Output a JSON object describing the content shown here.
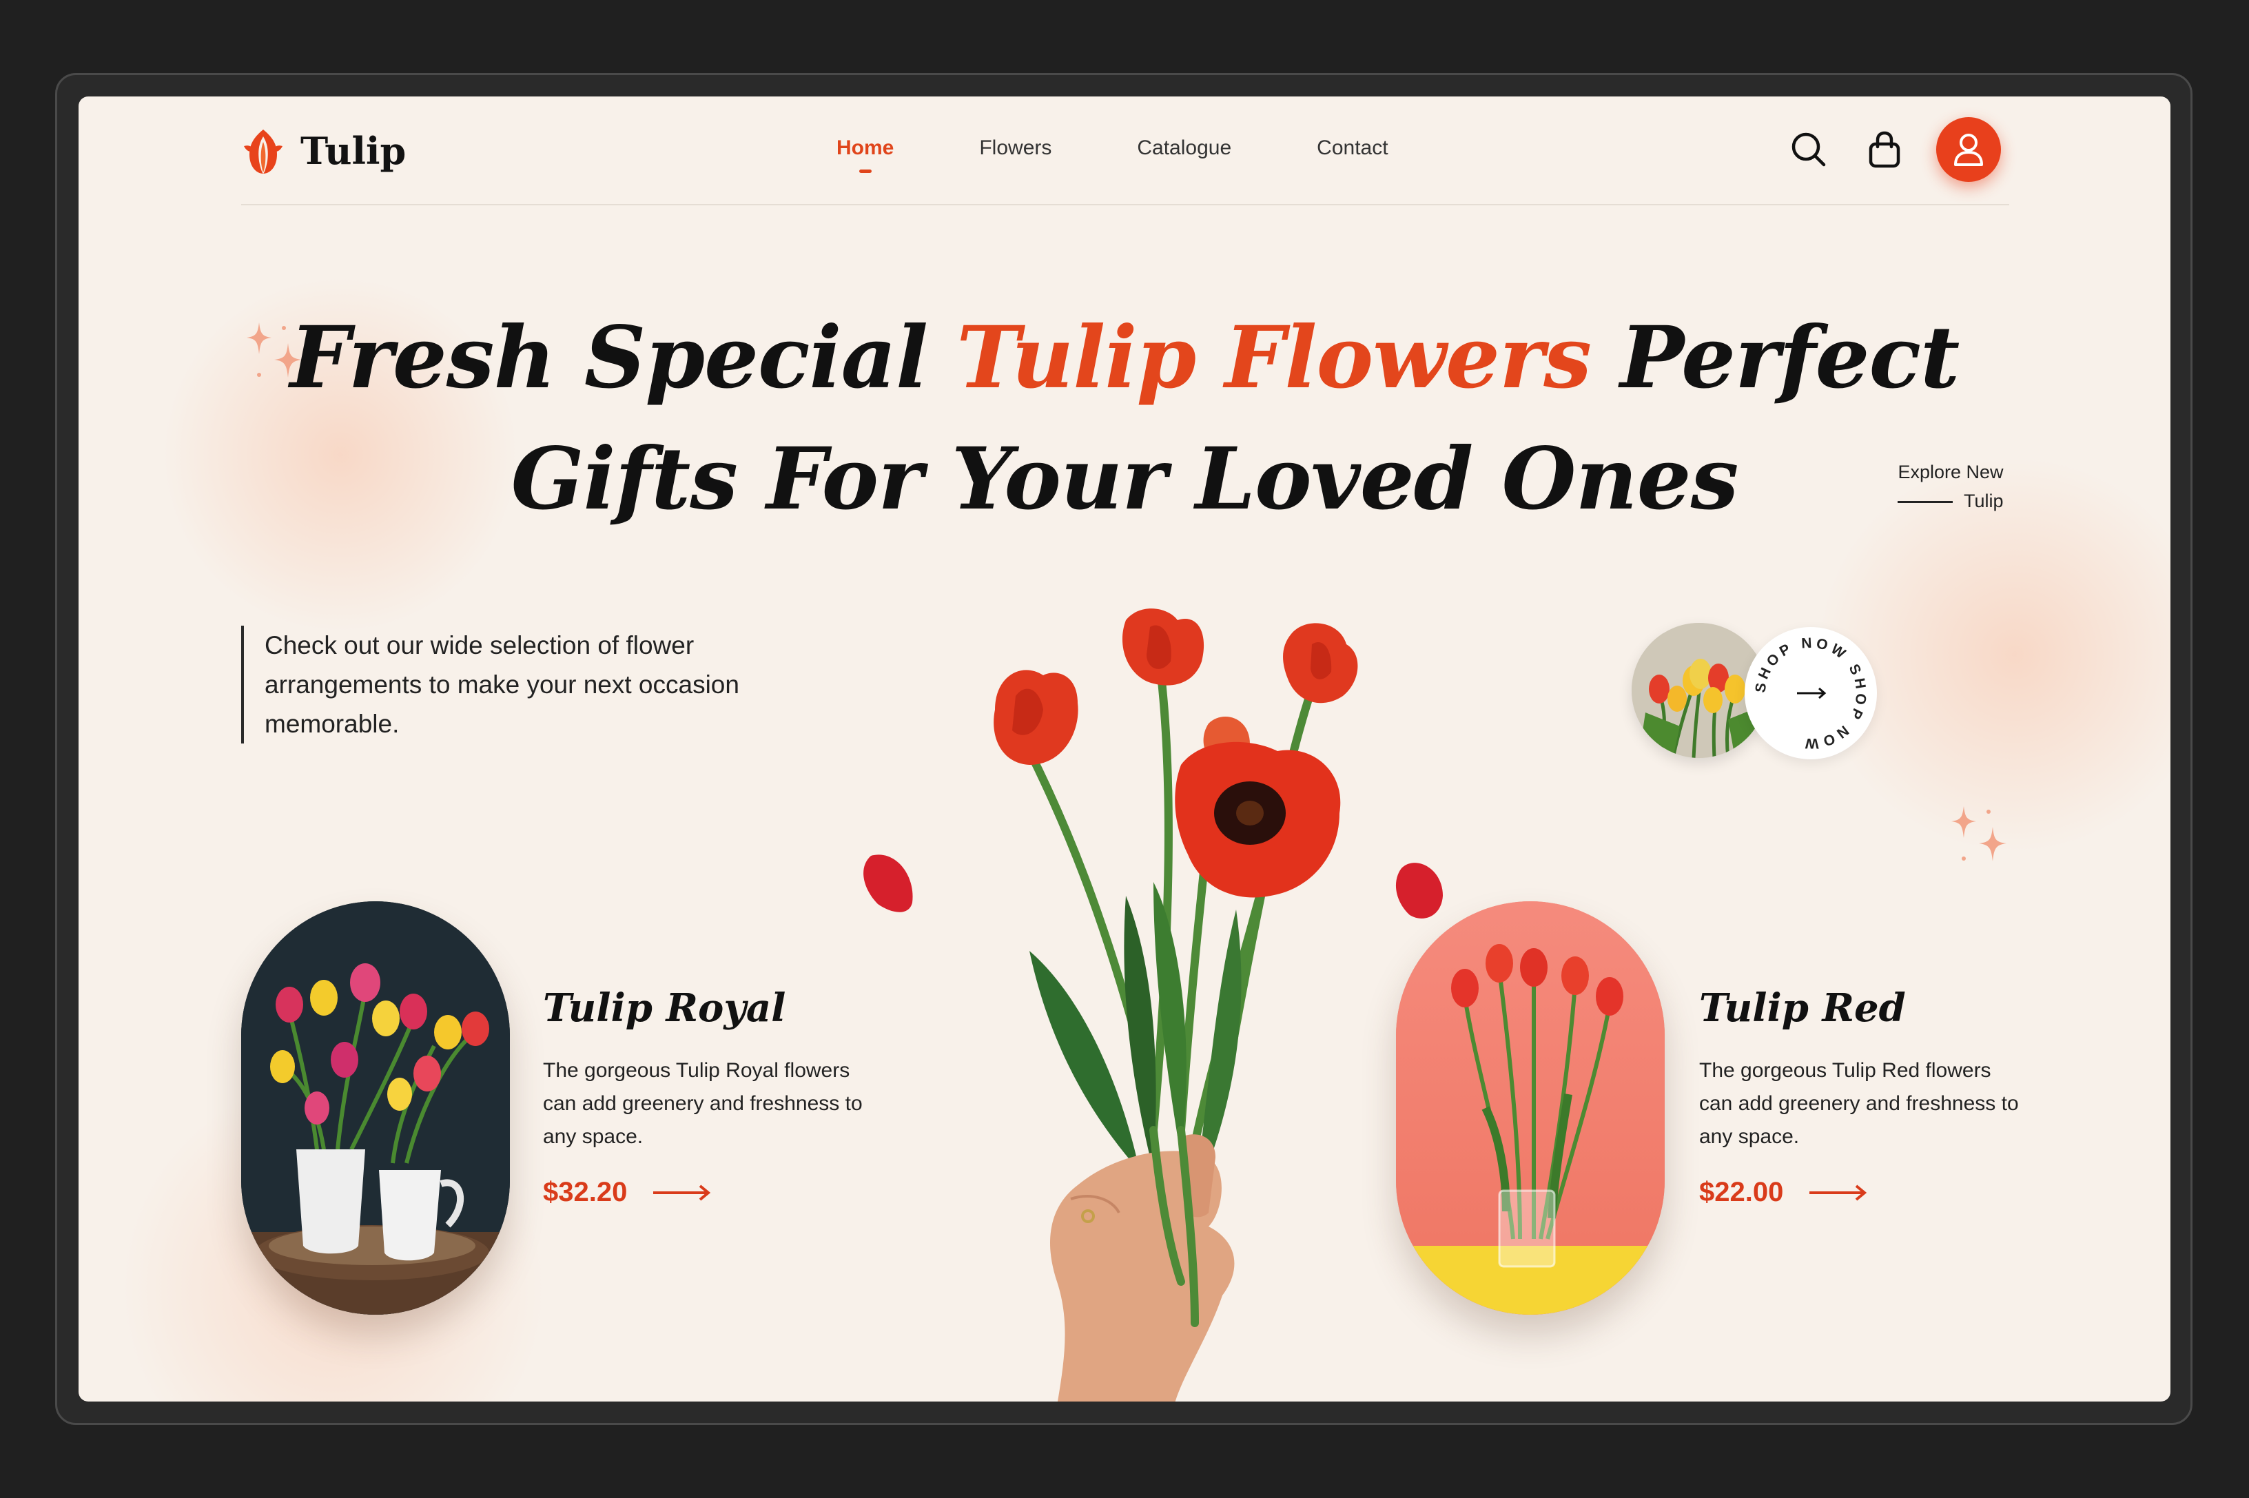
{
  "brand": {
    "name": "Tulip",
    "accent_color": "#e3461c"
  },
  "nav": {
    "items": [
      "Home",
      "Flowers",
      "Catalogue",
      "Contact"
    ],
    "active": "Home"
  },
  "header_icons": [
    "search-icon",
    "shopping-bag-icon",
    "user-icon"
  ],
  "hero": {
    "title_part1": "Fresh Special ",
    "title_accent": "Tulip Flowers",
    "title_part2": " Perfect",
    "title_line2": "Gifts For Your Loved Ones",
    "intro": "Check out our wide selection of flower arrangements to make your next occasion memorable."
  },
  "explore": {
    "line1": "Explore New",
    "line2": "Tulip"
  },
  "shop_badge": {
    "text": "SHOP NOW SHOP NOW"
  },
  "products": [
    {
      "name": "Tulip Royal",
      "description": "The gorgeous Tulip Royal flowers can add greenery and freshness to any space.",
      "price": "$32.20"
    },
    {
      "name": "Tulip Red",
      "description": "The gorgeous Tulip Red flowers can add greenery and freshness to any space.",
      "price": "$22.00"
    }
  ]
}
